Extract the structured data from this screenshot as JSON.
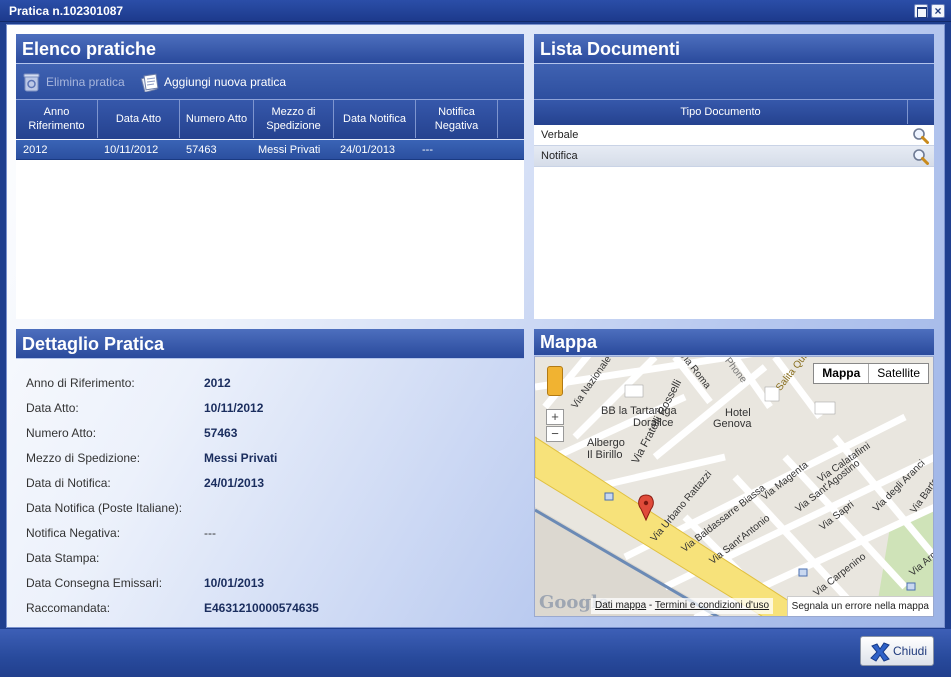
{
  "window": {
    "title": "Pratica n.102301087"
  },
  "elenco": {
    "title": "Elenco pratiche",
    "toolbar": {
      "delete_label": "Elimina pratica",
      "add_label": "Aggiungi nuova pratica"
    },
    "columns": [
      "Anno Riferimento",
      "Data Atto",
      "Numero Atto",
      "Mezzo di Spedizione",
      "Data Notifica",
      "Notifica Negativa"
    ],
    "rows": [
      {
        "anno": "2012",
        "data_atto": "10/11/2012",
        "numero": "57463",
        "mezzo": "Messi Privati",
        "data_notifica": "24/01/2013",
        "negativa": "---"
      }
    ]
  },
  "documenti": {
    "title": "Lista Documenti",
    "column": "Tipo Documento",
    "rows": [
      "Verbale",
      "Notifica"
    ]
  },
  "dettaglio": {
    "title": "Dettaglio Pratica",
    "fields": [
      {
        "label": "Anno di Riferimento:",
        "value": "2012"
      },
      {
        "label": "Data Atto:",
        "value": "10/11/2012"
      },
      {
        "label": "Numero Atto:",
        "value": "57463"
      },
      {
        "label": "Mezzo di Spedizione:",
        "value": "Messi Privati"
      },
      {
        "label": "Data di Notifica:",
        "value": "24/01/2013"
      },
      {
        "label": "Data Notifica (Poste Italiane):",
        "value": ""
      },
      {
        "label": "Notifica Negativa:",
        "value": "---"
      },
      {
        "label": "Data Stampa:",
        "value": ""
      },
      {
        "label": "Data Consegna Emissari:",
        "value": "10/01/2013"
      },
      {
        "label": "Raccomandata:",
        "value": "E4631210000574635"
      }
    ]
  },
  "mappa": {
    "title": "Mappa",
    "type_map": "Mappa",
    "type_satellite": "Satellite",
    "zoom_in": "+",
    "zoom_out": "−",
    "logo": "Google",
    "footer_data": "Dati mappa",
    "footer_sep": "-",
    "footer_terms": "Termini e condizioni d'uso",
    "report_error": "Segnala un errore nella mappa",
    "labels": {
      "roma": "Via Roma",
      "tartaruga": "BB la Tartaruga",
      "doralice": "Doralice",
      "hotel": "Hotel",
      "genova": "Genova",
      "albergo": "Albergo",
      "birillo": "Il Birillo",
      "rosselli": "Via Fratelli Rosselli",
      "rattazzi": "Via Urbano Rattazzi",
      "biassa": "Via Baldassarre Biassa",
      "santantonio": "Via Sant'Antonio",
      "magenta": "Via Magenta",
      "santagostino": "Via Sant'Agostino",
      "calatafimi": "Via Calatafimi",
      "sapri": "Via Sapri",
      "aranci": "Via degli Aranci",
      "bartolo": "Via Bartolo",
      "carpenino": "Via Carpenino",
      "arma": "Via Arma",
      "phone": "Phone",
      "salita": "Salita Quin",
      "nazionale": "Via Nazionale"
    }
  },
  "footer": {
    "close_label": "Chiudi"
  }
}
